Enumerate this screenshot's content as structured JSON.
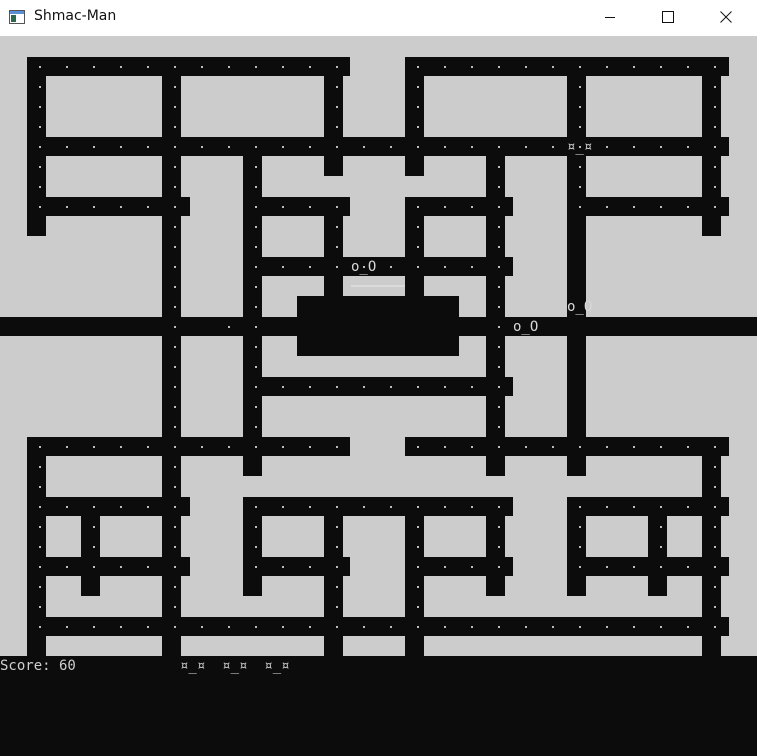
{
  "window": {
    "title": "Shmac-Man",
    "icon": "console-window-icon",
    "controls": [
      "minimize-icon",
      "maximize-icon",
      "close-icon"
    ]
  },
  "game": {
    "colors": {
      "wall": "#cccccc",
      "corridor": "#0c0c0c",
      "pellet": "#bdbdbd",
      "sprite_text": "#d8d8d8"
    },
    "player_glyph": "¤_¤",
    "ghost_glyph": "o_O",
    "ghost_count": 3
  },
  "hud": {
    "score_text": "Score: 60",
    "lives_text": "¤_¤  ¤_¤  ¤_¤"
  }
}
